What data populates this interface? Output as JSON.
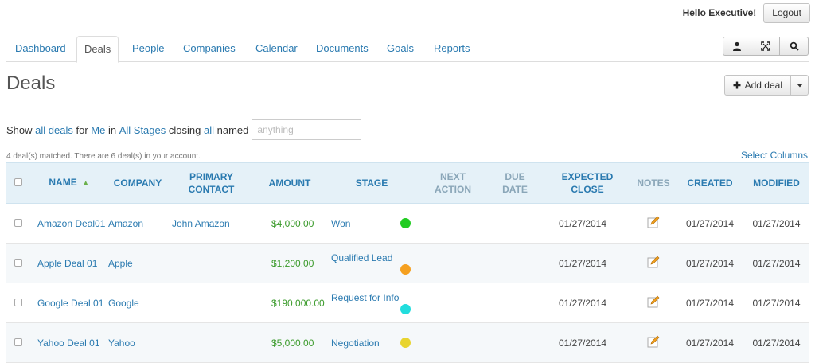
{
  "user": {
    "greeting": "Hello Executive!",
    "logout_label": "Logout"
  },
  "tabs": [
    {
      "label": "Dashboard",
      "active": false
    },
    {
      "label": "Deals",
      "active": true
    },
    {
      "label": "People",
      "active": false
    },
    {
      "label": "Companies",
      "active": false
    },
    {
      "label": "Calendar",
      "active": false
    },
    {
      "label": "Documents",
      "active": false
    },
    {
      "label": "Goals",
      "active": false
    },
    {
      "label": "Reports",
      "active": false
    }
  ],
  "toolbar_icons": [
    "person-icon",
    "fullscreen-icon",
    "search-icon"
  ],
  "page": {
    "title": "Deals",
    "add_deal_label": "Add deal"
  },
  "filter": {
    "show": "Show",
    "all_deals": "all deals",
    "for": "for",
    "me": "Me",
    "in": "in",
    "all_stages": "All Stages",
    "closing": "closing",
    "all": "all",
    "named": "named",
    "named_placeholder": "anything"
  },
  "summary": "4 deal(s) matched. There are 6 deal(s) in your account.",
  "select_columns": "Select Columns",
  "columns": {
    "name": "Name",
    "company": "Company",
    "primary_contact": "Primary Contact",
    "amount": "Amount",
    "stage": "Stage",
    "next_action": "Next Action",
    "due_date": "Due Date",
    "expected_close": "Expected Close",
    "notes": "Notes",
    "created": "Created",
    "modified": "Modified"
  },
  "colors": {
    "link": "#2a7ab0",
    "amount": "#3a9a2a",
    "header_bg": "#e5f1f8"
  },
  "deals": [
    {
      "name": "Amazon Deal01",
      "company": "Amazon",
      "contact": "John Amazon",
      "amount": "$4,000.00",
      "stage": "Won",
      "stage_color": "#22cc22",
      "expected_close": "01/27/2014",
      "created": "01/27/2014",
      "modified": "01/27/2014"
    },
    {
      "name": "Apple Deal 01",
      "company": "Apple",
      "contact": "",
      "amount": "$1,200.00",
      "stage": "Qualified Lead",
      "stage_color": "#f5a020",
      "expected_close": "01/27/2014",
      "created": "01/27/2014",
      "modified": "01/27/2014"
    },
    {
      "name": "Google Deal 01",
      "company": "Google",
      "contact": "",
      "amount": "$190,000.00",
      "stage": "Request for Info",
      "stage_color": "#22dddd",
      "expected_close": "01/27/2014",
      "created": "01/27/2014",
      "modified": "01/27/2014"
    },
    {
      "name": "Yahoo Deal 01",
      "company": "Yahoo",
      "contact": "",
      "amount": "$5,000.00",
      "stage": "Negotiation",
      "stage_color": "#e8d430",
      "expected_close": "01/27/2014",
      "created": "01/27/2014",
      "modified": "01/27/2014"
    }
  ]
}
